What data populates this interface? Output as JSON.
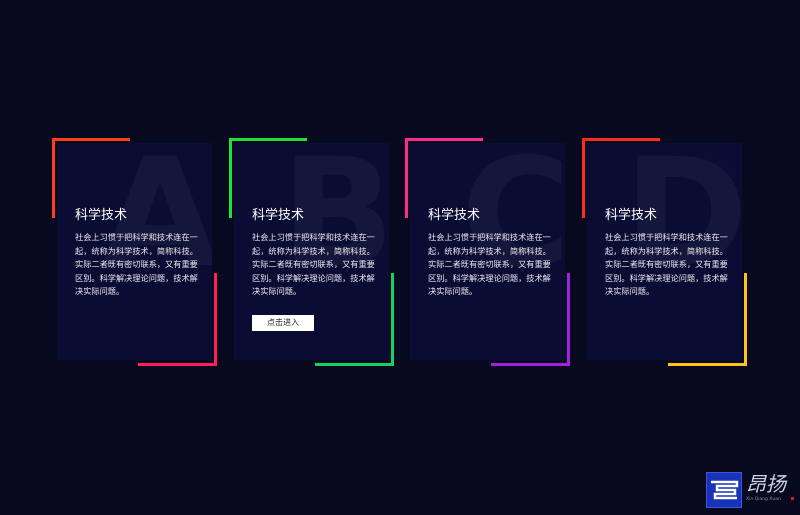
{
  "cards": [
    {
      "letter": "A",
      "title": "科学技术",
      "description": "社会上习惯于把科学和技术连在一起，统称为科学技术，简称科技。实际二者既有密切联系，又有重要区别。科学解决理论问题，技术解决实际问题。",
      "button": "",
      "colors": {
        "top": "#ff3d1a",
        "bottom": "#ff1f5a"
      }
    },
    {
      "letter": "B",
      "title": "科学技术",
      "description": "社会上习惯于把科学和技术连在一起，统称为科学技术，简称科技。实际二者既有密切联系，又有重要区别。科学解决理论问题，技术解决实际问题。",
      "button": "点击进入",
      "colors": {
        "top": "#1fe13a",
        "bottom": "#16d060"
      }
    },
    {
      "letter": "C",
      "title": "科学技术",
      "description": "社会上习惯于把科学和技术连在一起，统称为科学技术，简称科技。实际二者既有密切联系，又有重要区别。科学解决理论问题，技术解决实际问题。",
      "button": "",
      "colors": {
        "top": "#ff2a8c",
        "bottom": "#a51ee8"
      }
    },
    {
      "letter": "D",
      "title": "科学技术",
      "description": "社会上习惯于把科学和技术连在一起，统称为科学技术，简称科技。实际二者既有密切联系，又有重要区别。科学解决理论问题，技术解决实际问题。",
      "button": "",
      "colors": {
        "top": "#ff2a1a",
        "bottom": "#ffc21a"
      }
    }
  ],
  "watermark": {
    "text": "昂扬",
    "subtitle": "Xin Qiang Xuan"
  }
}
